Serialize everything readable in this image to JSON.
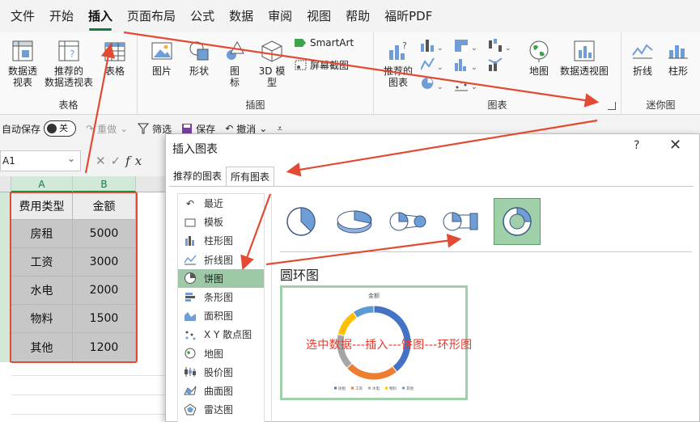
{
  "menu": {
    "tabs": [
      "文件",
      "开始",
      "插入",
      "页面布局",
      "公式",
      "数据",
      "审阅",
      "视图",
      "帮助",
      "福昕PDF"
    ],
    "active": "插入"
  },
  "ribbon": {
    "groups": {
      "tables": {
        "label": "表格",
        "pivot_line1": "数据透",
        "pivot_line2": "视表",
        "rec_pivot_line1": "推荐的",
        "rec_pivot_line2": "数据透视表",
        "table": "表格"
      },
      "illustrations": {
        "label": "插图",
        "pictures": "图片",
        "shapes": "形状",
        "icons_line1": "图",
        "icons_line2": "标",
        "model_line1": "3D 模",
        "model_line2": "型",
        "smartart": "SmartArt",
        "screenshot": "屏幕截图"
      },
      "charts": {
        "label": "图表",
        "rec_line1": "推荐的",
        "rec_line2": "图表",
        "map": "地图",
        "pivot_chart": "数据透视图"
      },
      "sparklines": {
        "label": "迷你图",
        "line": "折线",
        "column": "柱形"
      }
    }
  },
  "qat": {
    "autosave": "自动保存",
    "toggle": "关",
    "redo": "重做",
    "filter": "筛选",
    "save": "保存",
    "undo": "撤消"
  },
  "formula_bar": {
    "name_box": "A1",
    "fx": "fx"
  },
  "sheet": {
    "columns": [
      "A",
      "B"
    ],
    "header": [
      "费用类型",
      "金额"
    ],
    "rows": [
      [
        "房租",
        "5000"
      ],
      [
        "工资",
        "3000"
      ],
      [
        "水电",
        "2000"
      ],
      [
        "物料",
        "1500"
      ],
      [
        "其他",
        "1200"
      ]
    ]
  },
  "dialog": {
    "title": "插入图表",
    "help": "?",
    "close": "✕",
    "tabs": [
      "推荐的图表",
      "所有图表"
    ],
    "active_tab": "所有图表",
    "chart_types": [
      "最近",
      "模板",
      "柱形图",
      "折线图",
      "饼图",
      "条形图",
      "面积图",
      "X Y 散点图",
      "地图",
      "股价图",
      "曲面图",
      "雷达图"
    ],
    "selected_type": "饼图",
    "selected_subtype_title": "圆环图",
    "preview": {
      "title": "金额",
      "legend": [
        "房租",
        "工资",
        "水电",
        "物料",
        "其他"
      ]
    }
  },
  "chart_data": {
    "type": "pie",
    "title": "金额",
    "categories": [
      "房租",
      "工资",
      "水电",
      "物料",
      "其他"
    ],
    "values": [
      5000,
      3000,
      2000,
      1500,
      1200
    ],
    "colors": [
      "#4472c4",
      "#ed7d31",
      "#a5a5a5",
      "#ffc000",
      "#5b9bd5"
    ],
    "legend": "bottom"
  },
  "annotation": {
    "note": "选中数据---插入---饼图---环形图",
    "color": "#e03a2f"
  }
}
